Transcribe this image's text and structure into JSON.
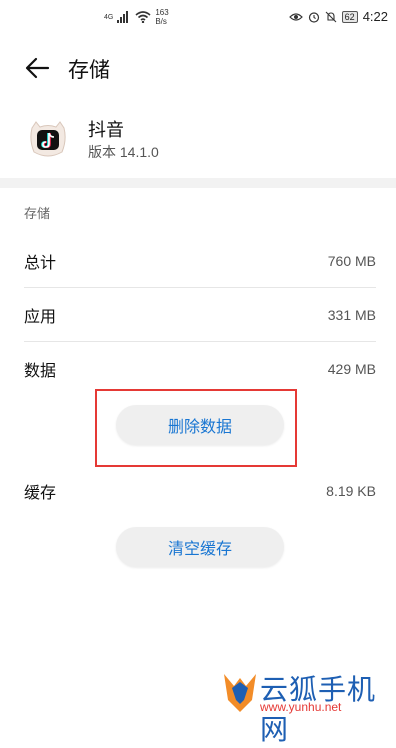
{
  "status_bar": {
    "network": "4G",
    "speed_value": "163",
    "speed_unit": "B/s",
    "battery": "62",
    "time": "4:22"
  },
  "header": {
    "title": "存储"
  },
  "app": {
    "name": "抖音",
    "version": "版本 14.1.0"
  },
  "storage": {
    "section_title": "存储",
    "rows": [
      {
        "label": "总计",
        "value": "760 MB"
      },
      {
        "label": "应用",
        "value": "331 MB"
      },
      {
        "label": "数据",
        "value": "429 MB"
      },
      {
        "label": "缓存",
        "value": "8.19 KB"
      }
    ],
    "clear_data_label": "删除数据",
    "clear_cache_label": "清空缓存"
  },
  "watermark": {
    "brand": "云狐手机网",
    "url": "www.yunhu.net"
  },
  "colors": {
    "accent": "#1976d2",
    "highlight": "#e53935",
    "watermark": "#1e5fb3"
  }
}
